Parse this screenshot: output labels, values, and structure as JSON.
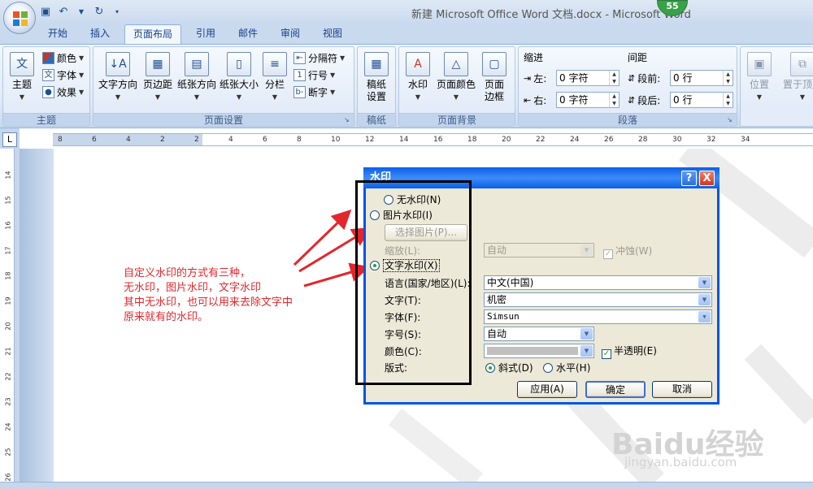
{
  "window": {
    "title": "新建 Microsoft Office Word 文档.docx - Microsoft Word",
    "notification_count": "55"
  },
  "tabs": [
    "开始",
    "插入",
    "页面布局",
    "引用",
    "邮件",
    "审阅",
    "视图"
  ],
  "active_tab": "页面布局",
  "ribbon": {
    "theme": {
      "label": "主题",
      "themes_button": "主题",
      "colors": "颜色",
      "fonts": "字体",
      "effects": "效果"
    },
    "page_setup": {
      "label": "页面设置",
      "text_direction": "文字方向",
      "margins": "页边距",
      "orientation": "纸张方向",
      "size": "纸张大小",
      "columns": "分栏",
      "breaks": "分隔符",
      "line_numbers": "行号",
      "hyphenation": "断字"
    },
    "paper": {
      "label": "稿纸",
      "setup_line1": "稿纸",
      "setup_line2": "设置"
    },
    "page_background": {
      "label": "页面背景",
      "watermark": "水印",
      "page_color": "页面颜色",
      "borders_line1": "页面",
      "borders_line2": "边框"
    },
    "paragraph": {
      "label": "段落",
      "indent_title": "缩进",
      "spacing_title": "间距",
      "left_label": "左:",
      "left_value": "0 字符",
      "right_label": "右:",
      "right_value": "0 字符",
      "before_label": "段前:",
      "before_value": "0 行",
      "after_label": "段后:",
      "after_value": "0 行"
    },
    "arrange": {
      "position": "位置",
      "wrap_top": "置于顶层"
    }
  },
  "ruler": {
    "corner": "L",
    "h_ticks": [
      "8",
      "6",
      "4",
      "2",
      "2",
      "4",
      "6",
      "8",
      "10",
      "12",
      "14",
      "16",
      "18",
      "20",
      "22",
      "24",
      "26",
      "28",
      "30",
      "32",
      "34"
    ],
    "v_ticks": [
      "14",
      "15",
      "16",
      "17",
      "18",
      "19",
      "20",
      "21",
      "22",
      "23",
      "24",
      "25",
      "26"
    ]
  },
  "annotation": {
    "line1": "自定义水印的方式有三种，",
    "line2": "无水印，图片水印，文字水印",
    "line3": "其中无水印，也可以用来去除文字中",
    "line4": "原来就有的水印。"
  },
  "dialog": {
    "title": "水印",
    "help": "?",
    "close": "X",
    "no_watermark": "无水印(N)",
    "picture_watermark": "图片水印(I)",
    "select_picture": "选择图片(P)...",
    "scale_label": "缩放(L):",
    "scale_value": "自动",
    "washout": "冲蚀(W)",
    "text_watermark": "文字水印(X)",
    "language_label": "语言(国家/地区)(L):",
    "language_value": "中文(中国)",
    "text_label": "文字(T):",
    "text_value": "机密",
    "font_label": "字体(F):",
    "font_value": "Simsun",
    "size_label": "字号(S):",
    "size_value": "自动",
    "color_label": "颜色(C):",
    "semi_transparent": "半透明(E)",
    "layout_label": "版式:",
    "diagonal": "斜式(D)",
    "horizontal": "水平(H)",
    "apply": "应用(A)",
    "ok": "确定",
    "cancel": "取消",
    "selected_option": "text_watermark"
  },
  "watermark_logo": {
    "brand": "Baidu经验",
    "url": "jingyan.baidu.com"
  },
  "colors": {
    "annotation_red": "#e3262b",
    "dialog_blue": "#0055e5",
    "radio_green": "#22a52b"
  }
}
